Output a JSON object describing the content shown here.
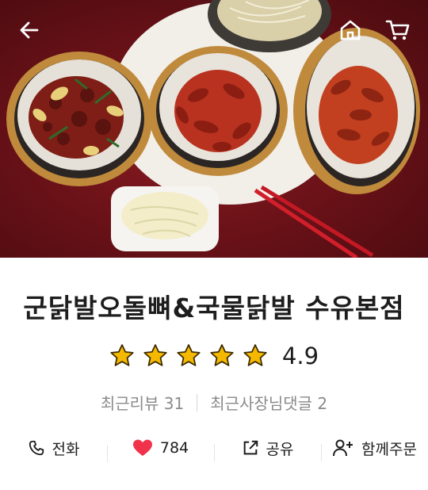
{
  "header": {
    "back_icon": "back-arrow-icon",
    "home_icon": "home-icon",
    "cart_icon": "cart-icon"
  },
  "store": {
    "name": "군닭발오돌뼈&국물닭발 수유본점",
    "rating": "4.9",
    "stars": 5,
    "star_color": "#f5b800"
  },
  "reviews": {
    "recent_reviews": "최근리뷰 31",
    "owner_comments": "최근사장님댓글 2"
  },
  "actions": [
    {
      "icon": "phone-icon",
      "label": "전화"
    },
    {
      "icon": "heart-icon",
      "label": "784",
      "color": "#f0324b"
    },
    {
      "icon": "share-icon",
      "label": "공유"
    },
    {
      "icon": "add-person-icon",
      "label": "함께주문"
    }
  ]
}
